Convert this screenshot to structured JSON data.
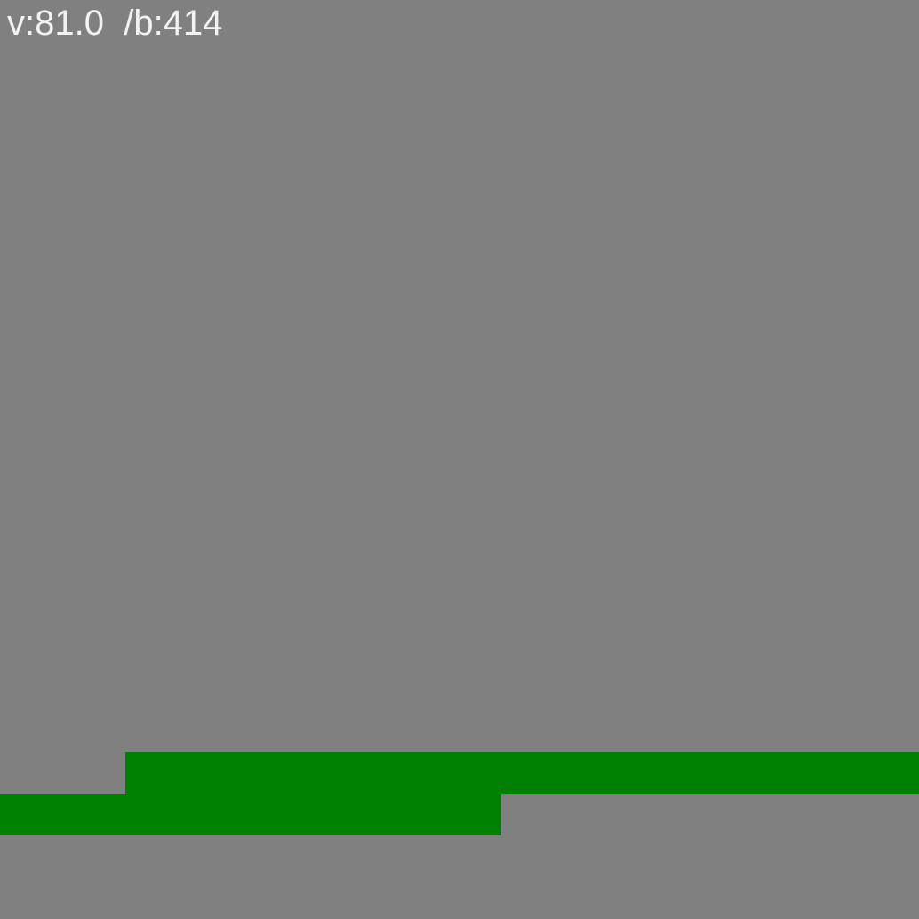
{
  "hud": {
    "velocity_text": "v:81.0",
    "separator": "  ",
    "b_text": "/b:414"
  },
  "colors": {
    "background": "#808080",
    "platform": "#008000",
    "hud_text": "#f2f2f2"
  }
}
